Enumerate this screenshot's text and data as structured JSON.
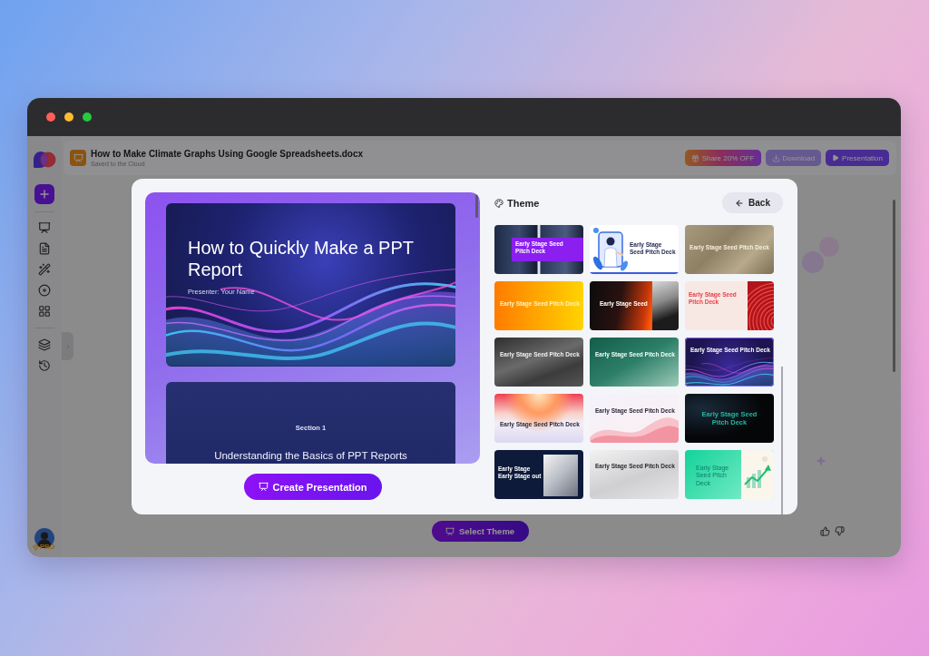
{
  "document": {
    "title": "How to Make Climate Graphs Using Google Spreadsheets.docx",
    "status": "Saved to the Cloud"
  },
  "header_buttons": [
    {
      "label": "Share 20% OFF",
      "kind": "promo"
    },
    {
      "label": "Download",
      "kind": "download"
    },
    {
      "label": "Presentation",
      "kind": "present"
    }
  ],
  "user": {
    "badge": "PRO"
  },
  "footer": {
    "button": "Select Theme"
  },
  "modal": {
    "preview": {
      "slides": [
        {
          "kind": "cover",
          "title": "How to Quickly Make a PPT Report",
          "subtitle": "Presenter: Your Name"
        },
        {
          "kind": "section",
          "label": "Section 1",
          "title": "Understanding the Basics of PPT Reports"
        }
      ]
    },
    "create_button": "Create Presentation",
    "heading": "Theme",
    "back_button": "Back",
    "themes": [
      {
        "title": "Early Stage Seed Pitch Deck",
        "kind": "city",
        "selected": false
      },
      {
        "title": "Early Stage Seed Pitch Deck",
        "kind": "illustration",
        "selected": false
      },
      {
        "title": "Early Stage Seed Pitch Deck",
        "kind": "room",
        "selected": false
      },
      {
        "title": "Early Stage Seed Pitch Deck",
        "kind": "orange",
        "selected": false
      },
      {
        "title": "Early Stage Seed",
        "kind": "dusk",
        "selected": false
      },
      {
        "title": "Early Stage Seed Pitch Deck",
        "kind": "coral",
        "selected": false
      },
      {
        "title": "Early Stage Seed Pitch Deck",
        "kind": "graphite",
        "selected": false
      },
      {
        "title": "Early Stage Seed Pitch Deck",
        "kind": "teal",
        "selected": false
      },
      {
        "title": "Early Stage Seed Pitch Deck",
        "kind": "waves",
        "selected": true
      },
      {
        "title": "Early Stage Seed Pitch Deck",
        "kind": "sunset",
        "selected": false
      },
      {
        "title": "Early Stage Seed Pitch Deck",
        "kind": "ribbon",
        "selected": false
      },
      {
        "title": "Early Stage Seed Pitch Deck",
        "kind": "midnight",
        "selected": false
      },
      {
        "title": "Early Stage Early Stage out",
        "kind": "building",
        "selected": false
      },
      {
        "title": "Early Stage Seed Pitch Deck",
        "kind": "silver",
        "selected": false
      },
      {
        "title": "Early Stage Seed Pitch Deck",
        "kind": "mint",
        "selected": false
      }
    ]
  }
}
